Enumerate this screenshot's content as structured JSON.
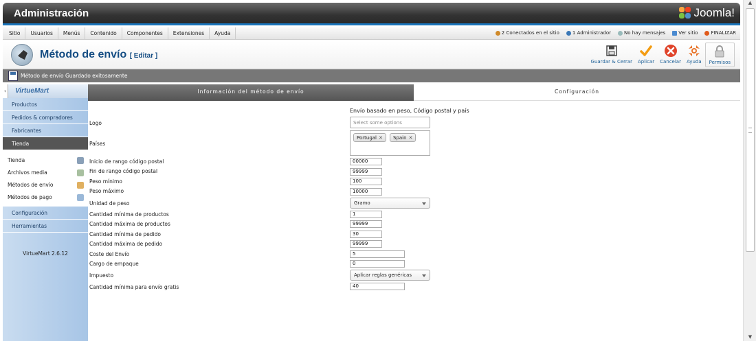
{
  "header": {
    "title": "Administración",
    "brand": "Joomla!"
  },
  "menubar": {
    "items": [
      "Sitio",
      "Usuarios",
      "Menús",
      "Contenido",
      "Componentes",
      "Extensiones",
      "Ayuda"
    ],
    "status": {
      "online": "2 Conectados en el sitio",
      "admins": "1 Administrador",
      "messages": "No hay mensajes",
      "view_site": "Ver sitio",
      "logout": "FINALIZAR"
    }
  },
  "toolbar": {
    "title": "Método de envío",
    "title_suffix": "[ Editar ]",
    "buttons": {
      "save_close": "Guardar & Cerrar",
      "apply": "Aplicar",
      "cancel": "Cancelar",
      "help": "Ayuda",
      "permissions": "Permisos"
    }
  },
  "message": "Método de envío Guardado exitosamente",
  "sidebar": {
    "logo": "VirtueMart",
    "groups": [
      "Productos",
      "Pedidos & compradores",
      "Fabricantes",
      "Tienda"
    ],
    "sub_items": [
      "Tienda",
      "Archivos media",
      "Métodos de envío",
      "Métodos de pago"
    ],
    "groups_after": [
      "Configuración",
      "Herramientas"
    ],
    "version": "VirtueMart 2.6.12"
  },
  "tabs": {
    "active": "Información del método de envío",
    "other": "Configuración"
  },
  "form": {
    "heading": "Envío basado en peso, Código postal y país",
    "logo_label": "Logo",
    "logo_placeholder": "Select some options",
    "countries_label": "Países",
    "countries": [
      "Portugal",
      "Spain"
    ],
    "zip_start_label": "Inicio de rango código postal",
    "zip_start": "00000",
    "zip_end_label": "Fin de rango código postal",
    "zip_end": "99999",
    "weight_min_label": "Peso mínimo",
    "weight_min": "100",
    "weight_max_label": "Peso máximo",
    "weight_max": "10000",
    "weight_unit_label": "Unidad de peso",
    "weight_unit": "Gramo",
    "products_min_label": "Cantidad mínima de productos",
    "products_min": "1",
    "products_max_label": "Cantidad máxima de productos",
    "products_max": "99999",
    "order_min_label": "Cantidad mínima de pedido",
    "order_min": "30",
    "order_max_label": "Cantidad máxima de pedido",
    "order_max": "99999",
    "shipping_cost_label": "Coste del Envío",
    "shipping_cost": "5",
    "package_fee_label": "Cargo de empaque",
    "package_fee": "0",
    "tax_label": "Impuesto",
    "tax": "Aplicar reglas genéricas",
    "free_shipping_label": "Cantidad mínima para envío gratis",
    "free_shipping": "40"
  }
}
